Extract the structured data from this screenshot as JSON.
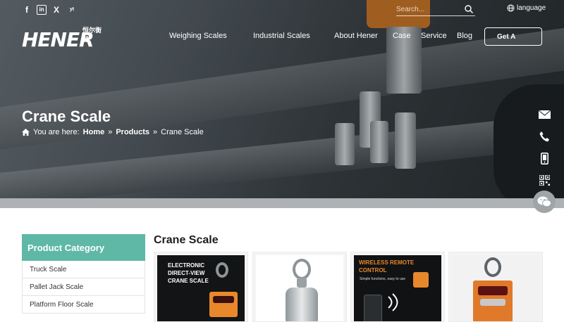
{
  "topbar": {
    "social": [
      "f",
      "in",
      "X",
      "yt"
    ],
    "search_placeholder": "Search...",
    "language_label": "language"
  },
  "logo": {
    "text": "HENER",
    "cn_text": "恒尔衡器"
  },
  "nav": {
    "items": [
      "Weighing Scales",
      "Industrial Scales",
      "About Hener",
      "Case",
      "Service",
      "Blog"
    ],
    "cta_label": "Get A"
  },
  "hero": {
    "title": "Crane Scale",
    "breadcrumb_prefix": "You are here:",
    "breadcrumbs": [
      "Home",
      "Products",
      "Crane Scale"
    ],
    "separator": "»"
  },
  "category": {
    "heading": "Product Category",
    "items": [
      "Truck Scale",
      "Pallet Jack Scale",
      "Platform Floor Scale"
    ]
  },
  "main": {
    "title": "Crane Scale",
    "products": [
      {
        "promo": "ELECTRONIC DIRECT-VIEW CRANE SCALE"
      },
      {
        "promo": ""
      },
      {
        "promo": "WIRELESS REMOTE CONTROL",
        "sub": "Simple functions, easy to use"
      },
      {
        "promo": ""
      }
    ]
  },
  "colors": {
    "accent": "#5fb8a6",
    "promo_orange": "#e8882a"
  }
}
